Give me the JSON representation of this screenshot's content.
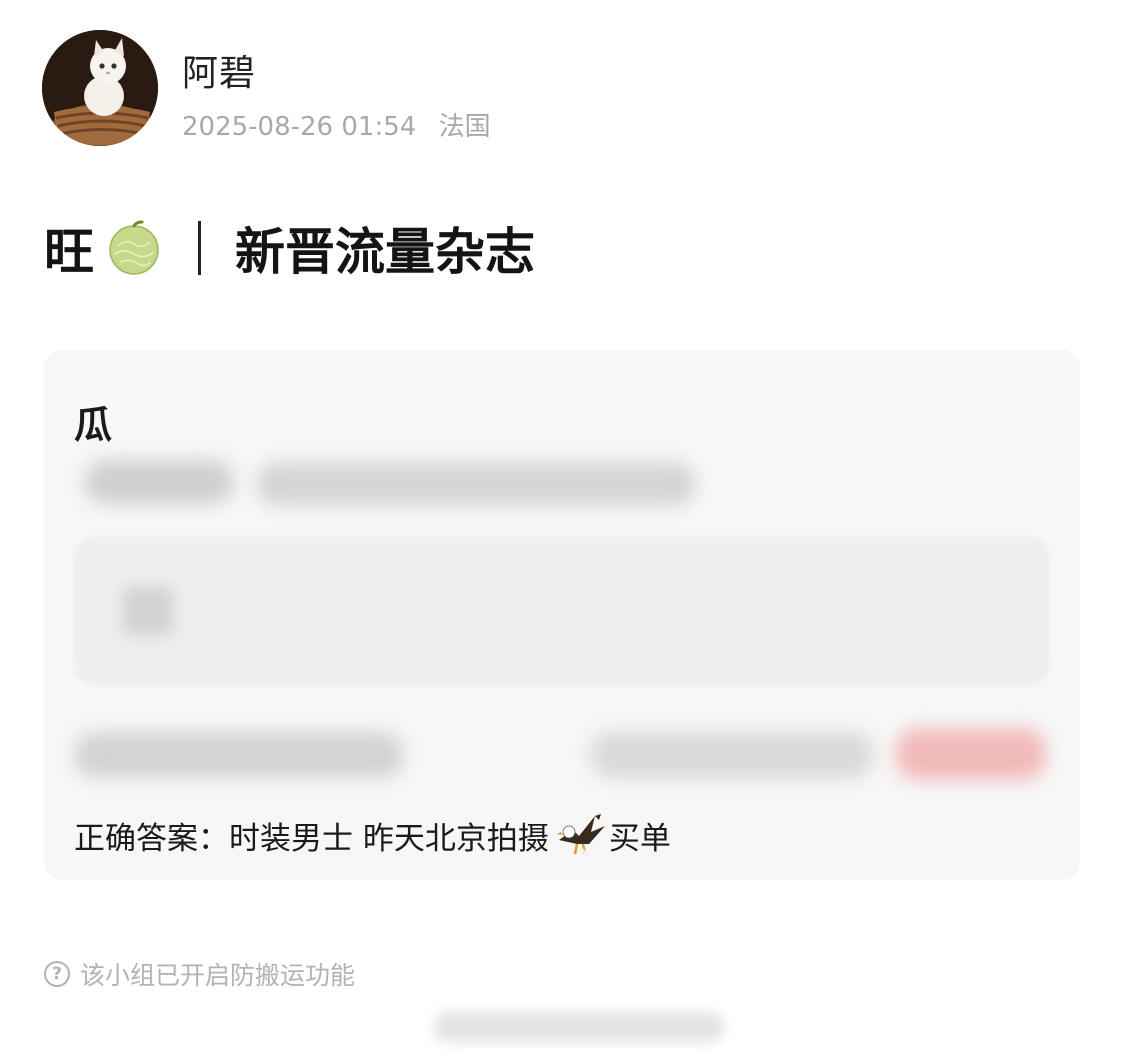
{
  "post": {
    "author": "阿碧",
    "date": "2025-08-26 01:54",
    "location": "法国",
    "title_prefix": "旺",
    "title_icon": "melon-emoji",
    "title": "新晋流量杂志"
  },
  "card": {
    "heading": "瓜",
    "answer": "正确答案：时装男士 昨天北京拍摄",
    "answer_icon": "eagle-emoji",
    "answer_suffix": "买单"
  },
  "footer": {
    "notice": "该小组已开启防搬运功能",
    "notice_icon": "help-circle-icon"
  },
  "colors": {
    "meta_gray": "#a9a9a9",
    "card_bg": "#f7f7f7",
    "title_text": "#141414"
  }
}
